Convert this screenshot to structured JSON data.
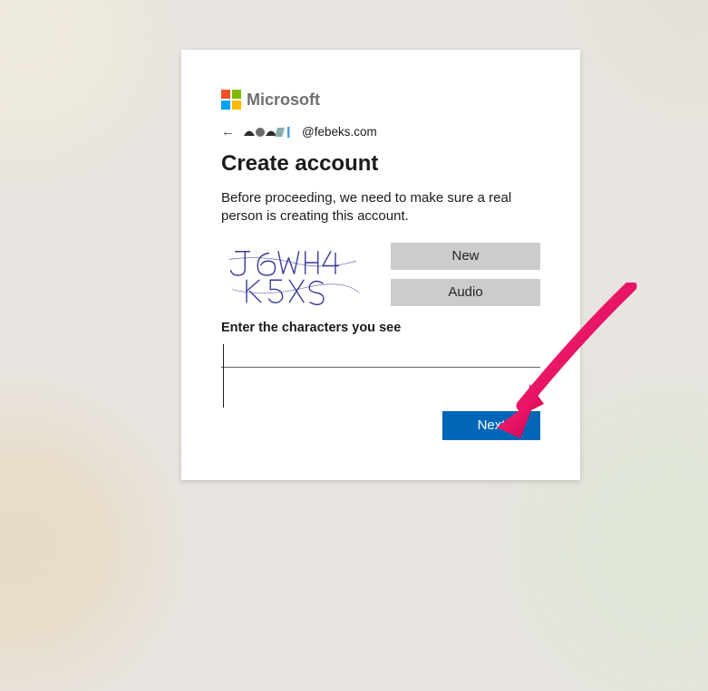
{
  "brand": {
    "name": "Microsoft",
    "colors": {
      "red": "#f25022",
      "green": "#7fba00",
      "blue": "#00a4ef",
      "yellow": "#ffb900"
    }
  },
  "identity": {
    "email_domain": "@febeks.com"
  },
  "page": {
    "title": "Create account",
    "description": "Before proceeding, we need to make sure a real person is creating this account."
  },
  "captcha": {
    "text_estimate": "J6WH4 K5XS",
    "new_label": "New",
    "audio_label": "Audio",
    "input_label": "Enter the characters you see",
    "input_value": ""
  },
  "buttons": {
    "next_label": "Next"
  },
  "colors": {
    "primary": "#0067b8",
    "gray_button": "#cccccc",
    "text": "#1b1b1b",
    "annotation_arrow": "#e8005e"
  }
}
